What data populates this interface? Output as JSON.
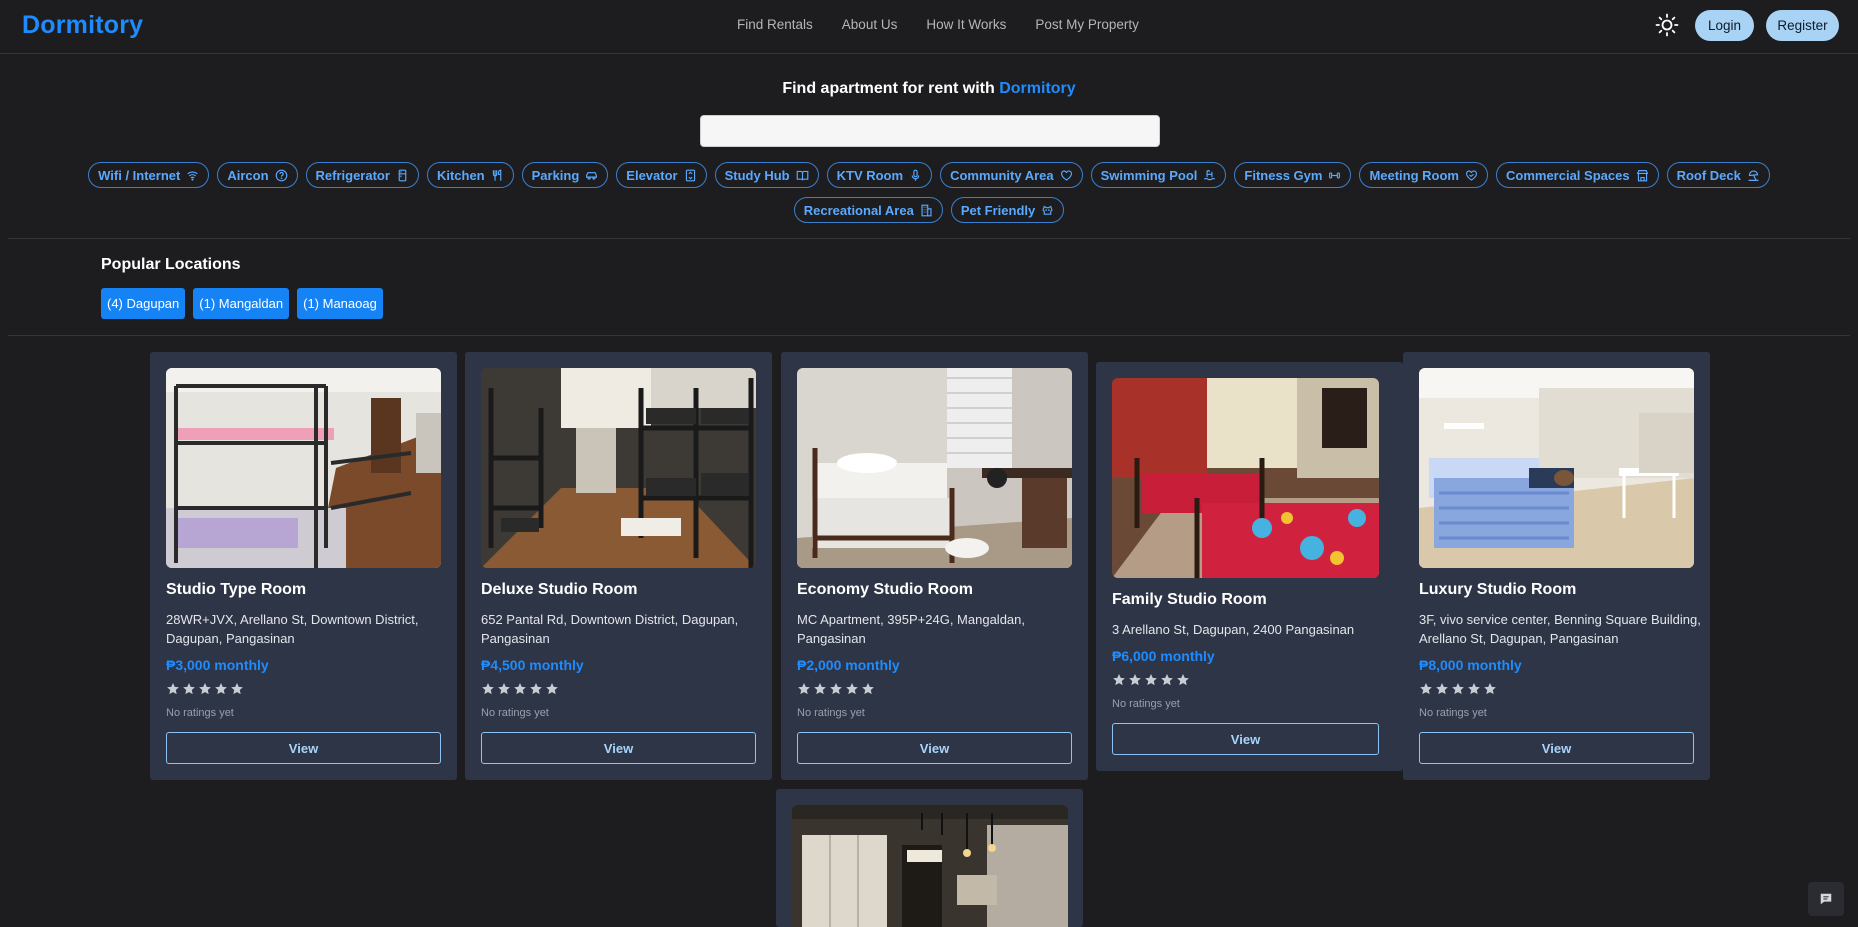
{
  "brand": "Dormitory",
  "nav": {
    "links": [
      "Find Rentals",
      "About Us",
      "How It Works",
      "Post My Property"
    ],
    "login": "Login",
    "register": "Register"
  },
  "search": {
    "title_prefix": "Find apartment for rent with ",
    "title_brand": "Dormitory",
    "value": ""
  },
  "amenities": [
    {
      "label": "Wifi / Internet",
      "icon": "wifi-icon"
    },
    {
      "label": "Aircon",
      "icon": "help-circle-icon"
    },
    {
      "label": "Refrigerator",
      "icon": "refrigerator-icon"
    },
    {
      "label": "Kitchen",
      "icon": "utensils-icon"
    },
    {
      "label": "Parking",
      "icon": "car-icon"
    },
    {
      "label": "Elevator",
      "icon": "elevator-icon"
    },
    {
      "label": "Study Hub",
      "icon": "book-icon"
    },
    {
      "label": "KTV Room",
      "icon": "microphone-icon"
    },
    {
      "label": "Community Area",
      "icon": "heart-icon"
    },
    {
      "label": "Swimming Pool",
      "icon": "pool-icon"
    },
    {
      "label": "Fitness Gym",
      "icon": "dumbbell-icon"
    },
    {
      "label": "Meeting Room",
      "icon": "handshake-icon"
    },
    {
      "label": "Commercial Spaces",
      "icon": "store-icon"
    },
    {
      "label": "Roof Deck",
      "icon": "sun-umbrella-icon"
    },
    {
      "label": "Recreational Area",
      "icon": "building-icon"
    },
    {
      "label": "Pet Friendly",
      "icon": "dog-icon"
    }
  ],
  "popular": {
    "title": "Popular Locations",
    "items": [
      "(4) Dagupan",
      "(1) Mangaldan",
      "(1) Manaoag"
    ]
  },
  "listings": [
    {
      "title": "Studio Type Room",
      "address": "28WR+JVX, Arellano St, Downtown District, Dagupan, Pangasinan",
      "price": "₱3,000 monthly",
      "stars": 5,
      "rating_text": "No ratings yet",
      "view": "View"
    },
    {
      "title": "Deluxe Studio Room",
      "address": "652 Pantal Rd, Downtown District, Dagupan, Pangasinan",
      "price": "₱4,500 monthly",
      "stars": 5,
      "rating_text": "No ratings yet",
      "view": "View"
    },
    {
      "title": "Economy Studio Room",
      "address": "MC Apartment, 395P+24G, Mangaldan, Pangasinan",
      "price": "₱2,000 monthly",
      "stars": 5,
      "rating_text": "No ratings yet",
      "view": "View"
    },
    {
      "title": "Family Studio Room",
      "address": "3 Arellano St, Dagupan, 2400 Pangasinan",
      "price": "₱6,000 monthly",
      "stars": 5,
      "rating_text": "No ratings yet",
      "view": "View"
    },
    {
      "title": "Luxury Studio Room",
      "address": "3F, vivo service center, Benning Square Building, Arellano St, Dagupan, Pangasinan",
      "price": "₱8,000 monthly",
      "stars": 5,
      "rating_text": "No ratings yet",
      "view": "View"
    }
  ]
}
